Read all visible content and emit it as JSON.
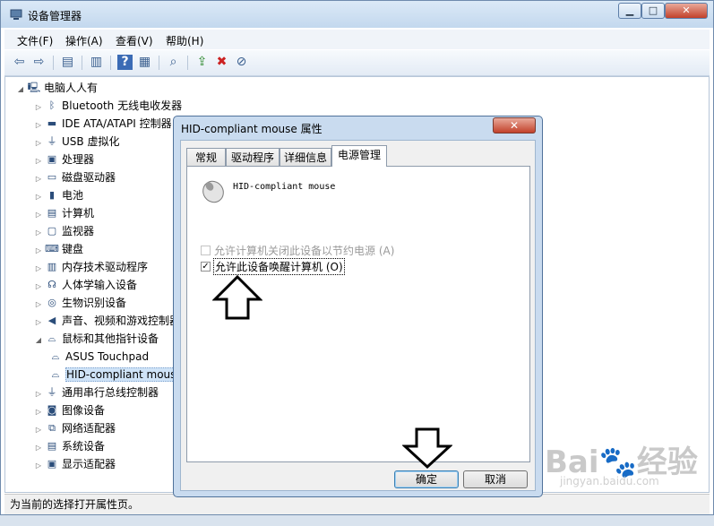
{
  "window": {
    "title": "设备管理器"
  },
  "menu": [
    "文件(F)",
    "操作(A)",
    "查看(V)",
    "帮助(H)"
  ],
  "tree": {
    "root": "电脑人人有",
    "items": [
      {
        "label": "Bluetooth 无线电收发器",
        "icon": "bluetooth-icon"
      },
      {
        "label": "IDE ATA/ATAPI 控制器",
        "icon": "ide-icon"
      },
      {
        "label": "USB 虚拟化",
        "icon": "usb-icon"
      },
      {
        "label": "处理器",
        "icon": "cpu-icon"
      },
      {
        "label": "磁盘驱动器",
        "icon": "disk-icon"
      },
      {
        "label": "电池",
        "icon": "battery-icon"
      },
      {
        "label": "计算机",
        "icon": "computer-icon"
      },
      {
        "label": "监视器",
        "icon": "monitor-icon"
      },
      {
        "label": "键盘",
        "icon": "keyboard-icon"
      },
      {
        "label": "内存技术驱动程序",
        "icon": "memory-icon"
      },
      {
        "label": "人体学输入设备",
        "icon": "hid-icon"
      },
      {
        "label": "生物识别设备",
        "icon": "fingerprint-icon"
      },
      {
        "label": "声音、视频和游戏控制器",
        "icon": "speaker-icon"
      },
      {
        "label": "鼠标和其他指针设备",
        "icon": "mouse-icon",
        "expanded": true
      },
      {
        "label": "ASUS Touchpad",
        "icon": "mouse-icon",
        "child": true
      },
      {
        "label": "HID-compliant mouse",
        "icon": "mouse-icon",
        "child": true,
        "selected": true
      },
      {
        "label": "通用串行总线控制器",
        "icon": "usb-icon"
      },
      {
        "label": "图像设备",
        "icon": "camera-icon"
      },
      {
        "label": "网络适配器",
        "icon": "network-icon"
      },
      {
        "label": "系统设备",
        "icon": "system-icon"
      },
      {
        "label": "显示适配器",
        "icon": "display-icon"
      }
    ]
  },
  "status": "为当前的选择打开属性页。",
  "dialog": {
    "title": "HID-compliant mouse 属性",
    "tabs": [
      "常规",
      "驱动程序",
      "详细信息",
      "电源管理"
    ],
    "device_name": "HID-compliant mouse",
    "option1": "允许计算机关闭此设备以节约电源 (A)",
    "option2": "允许此设备唤醒计算机 (O)",
    "ok": "确定",
    "cancel": "取消"
  },
  "watermark": {
    "logo": "Bai🐾经验",
    "url": "jingyan.baidu.com"
  }
}
